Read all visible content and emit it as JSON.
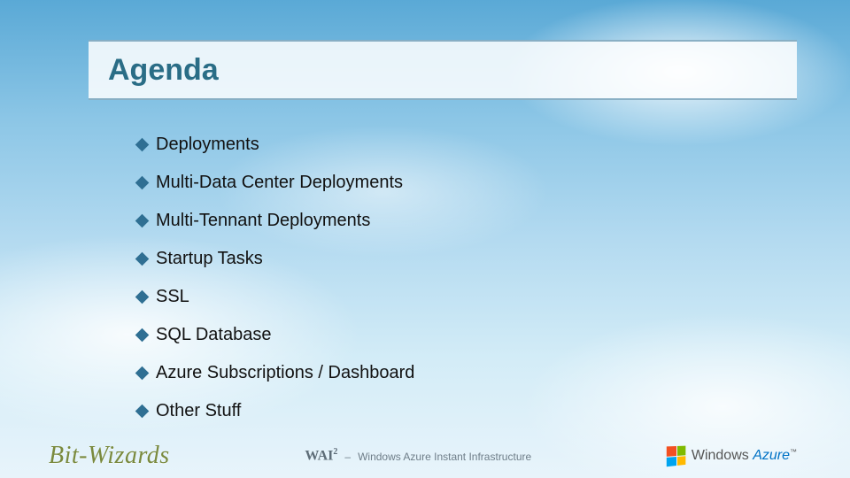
{
  "title": "Agenda",
  "bullets": [
    "Deployments",
    "Multi-Data Center Deployments",
    "Multi-Tennant Deployments",
    "Startup Tasks",
    "SSL",
    "SQL Database",
    "Azure Subscriptions / Dashboard",
    "Other Stuff"
  ],
  "footer": {
    "left_logo_text": "Bit-Wizards",
    "center_acronym": "WAI",
    "center_super": "2",
    "center_separator": "–",
    "center_expansion": "Windows Azure Instant Infrastructure",
    "right_logo_windows": "Windows",
    "right_logo_azure": "Azure",
    "right_logo_tm": "™"
  },
  "colors": {
    "title_color": "#2a6d86",
    "bullet_color": "#2f6f93"
  }
}
